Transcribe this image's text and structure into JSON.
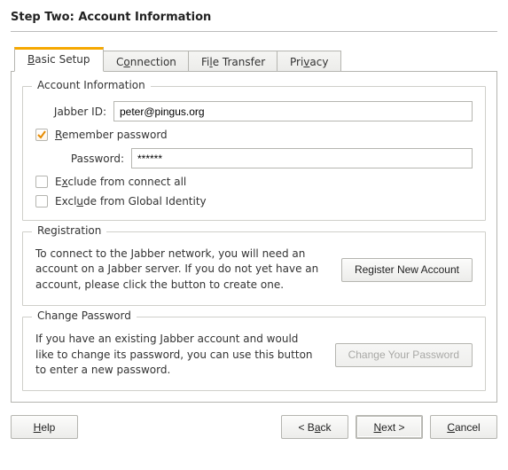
{
  "heading": "Step Two: Account Information",
  "tabs": {
    "basic": {
      "pre": "",
      "u": "B",
      "post": "asic Setup"
    },
    "conn": {
      "pre": "C",
      "u": "o",
      "post": "nnection"
    },
    "file": {
      "pre": "Fi",
      "u": "l",
      "post": "e Transfer"
    },
    "priv": {
      "pre": "Pri",
      "u": "v",
      "post": "acy"
    }
  },
  "group_account": {
    "title": "Account Information",
    "jabber_label": "Jabber ID:",
    "jabber_value": "peter@pingus.org",
    "remember": {
      "pre": "",
      "u": "R",
      "post": "emember password",
      "checked": true
    },
    "password_label": "Password:",
    "password_value": "******",
    "exclude_all": {
      "pre": "E",
      "u": "x",
      "post": "clude from connect all",
      "checked": false
    },
    "exclude_global": {
      "pre": "Excl",
      "u": "u",
      "post": "de from Global Identity",
      "checked": false
    }
  },
  "group_reg": {
    "title": "Registration",
    "desc": "To connect to the Jabber network, you will need an account on a Jabber server.  If you do not yet have an account, please click the button to create one.",
    "button": "Register New Account"
  },
  "group_pw": {
    "title": "Change Password",
    "desc": "If you have an existing Jabber account and would like to change its password, you can use this button to enter a new password.",
    "button": "Change Your Password"
  },
  "footer": {
    "help": {
      "pre": "",
      "u": "H",
      "post": "elp"
    },
    "back": {
      "pre": "< B",
      "u": "a",
      "post": "ck"
    },
    "next": {
      "pre": "",
      "u": "N",
      "post": "ext >"
    },
    "cancel": {
      "pre": "",
      "u": "C",
      "post": "ancel"
    }
  }
}
